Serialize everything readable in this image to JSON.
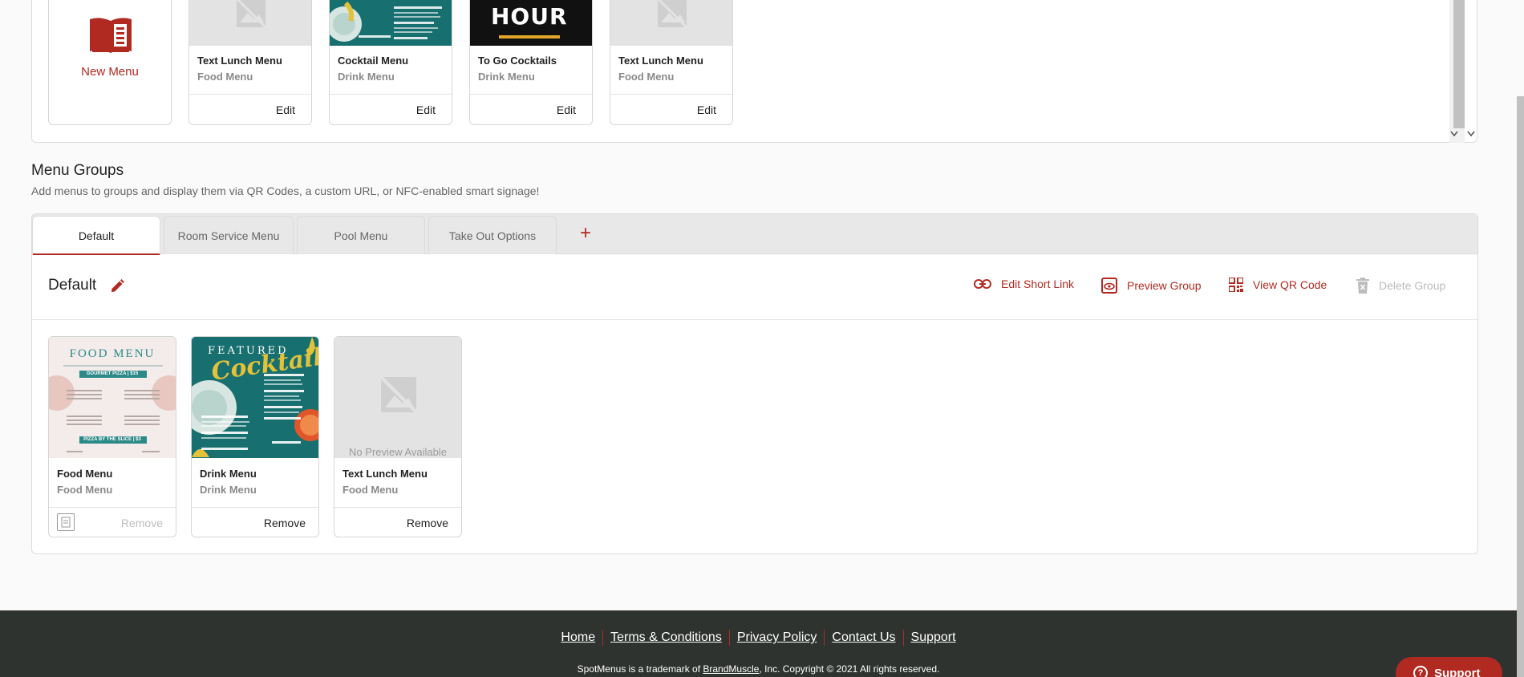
{
  "menus_panel": {
    "new_menu_label": "New Menu",
    "cards": [
      {
        "name": "Text Lunch Menu",
        "type": "Food Menu",
        "action": "Edit",
        "thumb": "placeholder"
      },
      {
        "name": "Cocktail Menu",
        "type": "Drink Menu",
        "action": "Edit",
        "thumb": "cocktail"
      },
      {
        "name": "To Go Cocktails",
        "type": "Drink Menu",
        "action": "Edit",
        "thumb": "hour"
      },
      {
        "name": "Text Lunch Menu",
        "type": "Food Menu",
        "action": "Edit",
        "thumb": "placeholder"
      }
    ],
    "hour_text": "HOUR"
  },
  "menu_groups": {
    "title": "Menu Groups",
    "description": "Add menus to groups and display them via QR Codes, a custom URL, or NFC-enabled smart signage!",
    "tabs": [
      {
        "label": "Default",
        "active": true
      },
      {
        "label": "Room Service Menu",
        "active": false
      },
      {
        "label": "Pool Menu",
        "active": false
      },
      {
        "label": "Take Out Options",
        "active": false
      }
    ],
    "add_tab_symbol": "+",
    "current_group": {
      "name": "Default",
      "actions": {
        "edit_short_link": "Edit Short Link",
        "preview_group": "Preview Group",
        "view_qr_code": "View QR Code",
        "delete_group": "Delete Group"
      },
      "cards": [
        {
          "name": "Food Menu",
          "type": "Food Menu",
          "action": "Remove",
          "action_disabled": true,
          "thumb": "food"
        },
        {
          "name": "Drink Menu",
          "type": "Drink Menu",
          "action": "Remove",
          "action_disabled": false,
          "thumb": "cocktail"
        },
        {
          "name": "Text Lunch Menu",
          "type": "Food Menu",
          "action": "Remove",
          "action_disabled": false,
          "thumb": "placeholder"
        }
      ],
      "no_preview_text": "No Preview Available"
    }
  },
  "thumb_text": {
    "food_menu_title": "FOOD MENU",
    "food_gourmet": "GOURMET PIZZA | $15",
    "food_slice": "PIZZA BY THE SLICE | $3",
    "featured": "FEATURED",
    "cocktails_script": "Cocktails"
  },
  "footer": {
    "links": [
      "Home",
      "Terms & Conditions",
      "Privacy Policy",
      "Contact Us",
      "Support"
    ],
    "copyright_pre": "SpotMenus is a trademark of ",
    "copyright_link": "BrandMuscle",
    "copyright_post": ", Inc. Copyright © 2021 All rights reserved.",
    "support_button": "Support"
  },
  "colors": {
    "brand_red": "#b02a22",
    "footer_bg": "#2f3330",
    "teal": "#17706f"
  }
}
